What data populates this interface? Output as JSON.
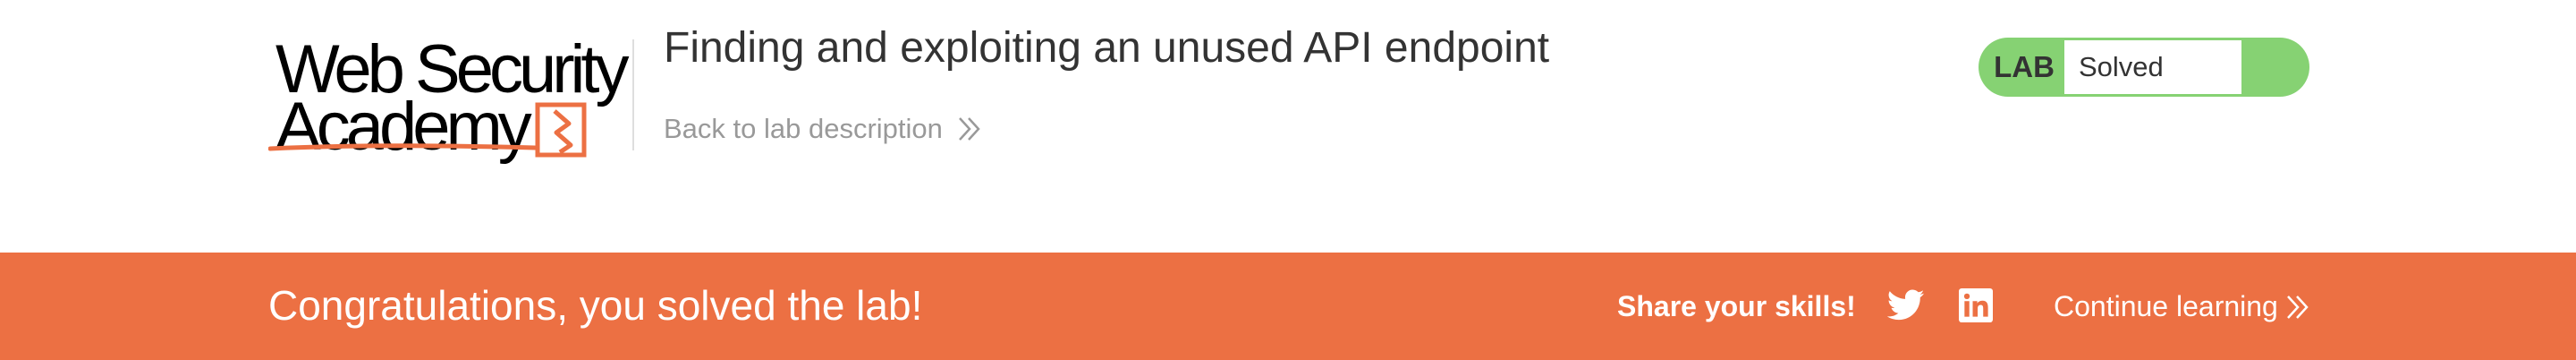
{
  "logo": {
    "line1": "Web Security",
    "line2": "Academy"
  },
  "header": {
    "title": "Finding and exploiting an unused API endpoint",
    "back_link": "Back to lab description"
  },
  "lab_status": {
    "tag": "LAB",
    "value": "Solved",
    "accent_color": "#86d273"
  },
  "banner": {
    "message": "Congratulations, you solved the lab!",
    "share_label": "Share your skills!",
    "continue_label": "Continue learning",
    "background_color": "#ec7043"
  },
  "icons": {
    "share": [
      "twitter-icon",
      "linkedin-icon"
    ],
    "links": [
      "chevron-right-double-icon"
    ]
  }
}
